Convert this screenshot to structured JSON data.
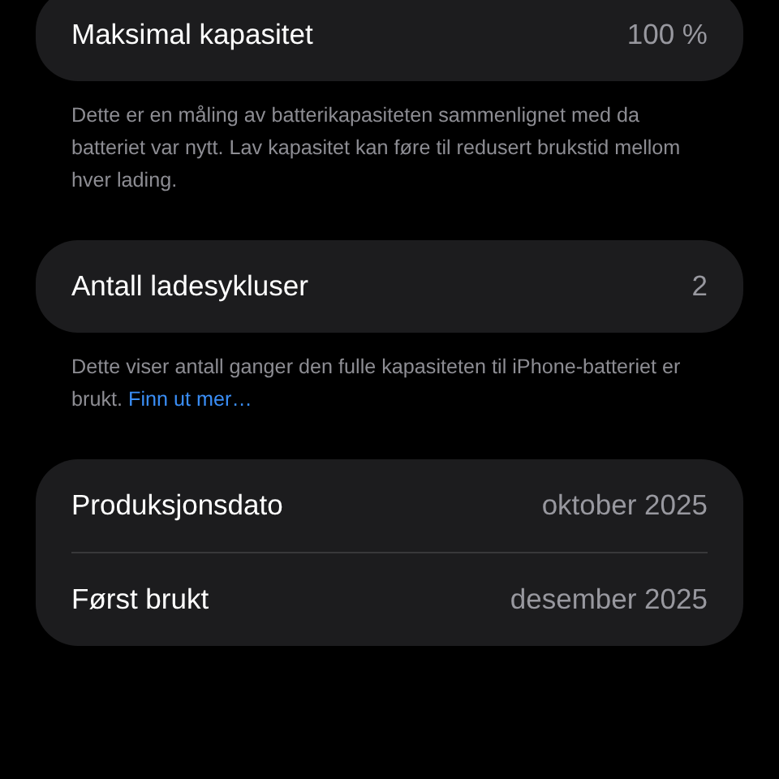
{
  "sections": [
    {
      "rows": [
        {
          "label": "Maksimal kapasitet",
          "value": "100 %"
        }
      ],
      "footer": {
        "text": "Dette er en måling av batterikapasiteten sammenlignet med da batteriet var nytt. Lav kapasitet kan føre til redusert brukstid mellom hver lading."
      }
    },
    {
      "rows": [
        {
          "label": "Antall ladesykluser",
          "value": "2"
        }
      ],
      "footer": {
        "text": "Dette viser antall ganger den fulle kapasiteten til iPhone-batteriet er brukt.",
        "link": "Finn ut mer…"
      }
    },
    {
      "rows": [
        {
          "label": "Produksjonsdato",
          "value": "oktober 2025"
        },
        {
          "label": "Først brukt",
          "value": "desember 2025"
        }
      ]
    }
  ]
}
